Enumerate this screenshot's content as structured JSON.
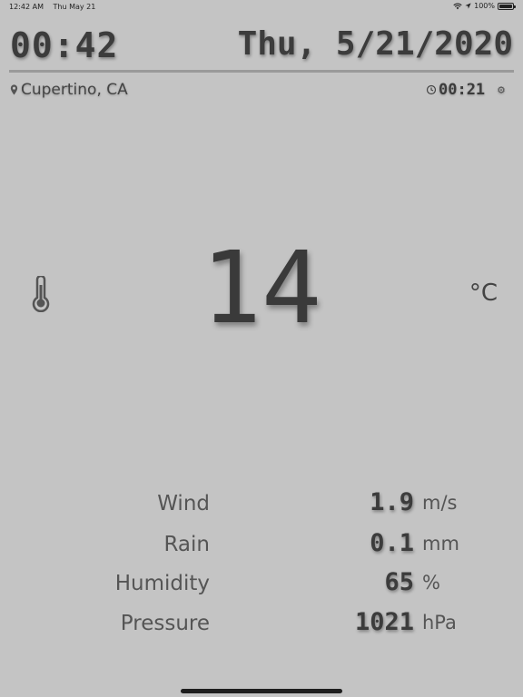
{
  "status_bar": {
    "time": "12:42 AM",
    "date": "Thu May 21",
    "battery": "100%",
    "battery_level": 1.0
  },
  "header": {
    "time": "00:42",
    "date": "Thu, 5/21/2020"
  },
  "info": {
    "location": "Cupertino, CA",
    "last_update": "00:21"
  },
  "current": {
    "temperature": "14",
    "unit": "°C"
  },
  "details": [
    {
      "label": "Wind",
      "value": "1.9",
      "unit": "m/s"
    },
    {
      "label": "Rain",
      "value": "0.1",
      "unit": "mm"
    },
    {
      "label": "Humidity",
      "value": "65",
      "unit": "%"
    },
    {
      "label": "Pressure",
      "value": "1021",
      "unit": "hPa"
    }
  ],
  "icons": {
    "location": "map-pin-icon",
    "refresh": "clock-refresh-icon",
    "settings": "gear-icon",
    "thermometer": "thermometer-icon",
    "wifi": "wifi-icon",
    "location_arrow": "location-arrow-icon",
    "battery": "battery-icon"
  },
  "colors": {
    "background": "#c4c4c4",
    "text": "#3a3a3a",
    "divider": "#9a9a9a"
  }
}
